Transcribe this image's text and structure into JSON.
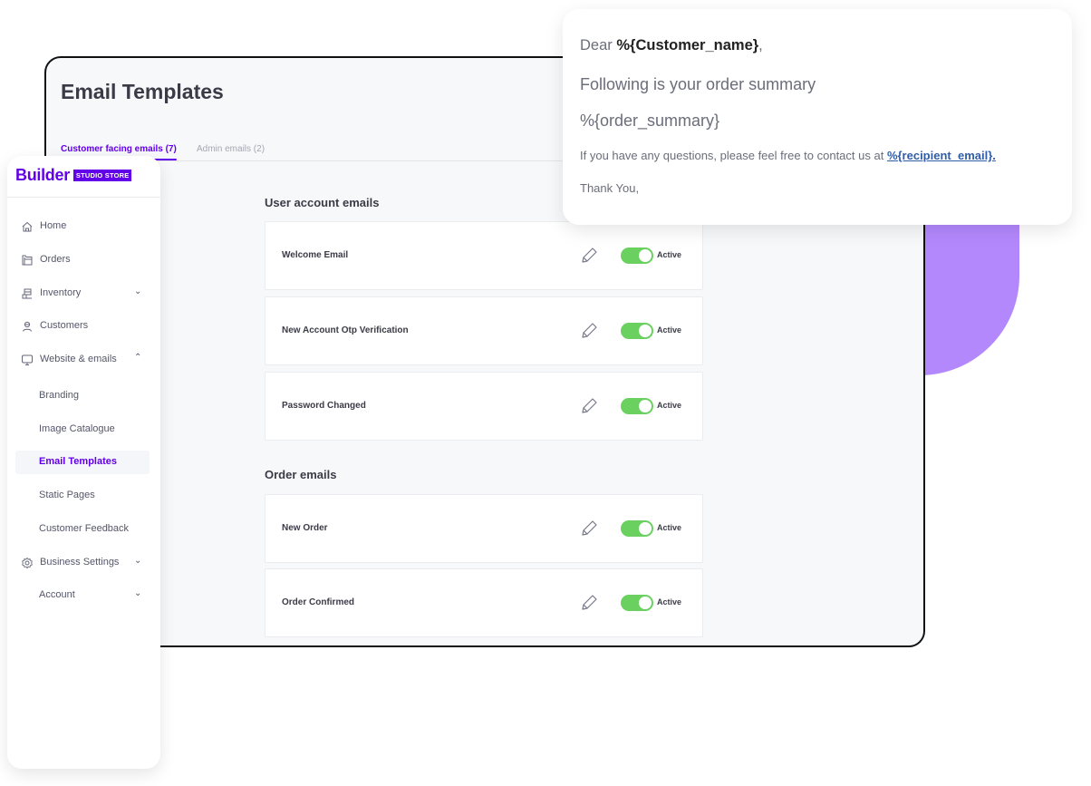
{
  "colors": {
    "brand": "#6200ea",
    "toggle_on": "#6ad160",
    "decor_purple": "#b388fd",
    "link": "#2f5da8"
  },
  "sidebar": {
    "logo": {
      "text": "Builder",
      "badge": "STUDIO STORE"
    },
    "items": [
      {
        "label": "Home",
        "icon": "home-icon"
      },
      {
        "label": "Orders",
        "icon": "orders-icon"
      },
      {
        "label": "Inventory",
        "icon": "inventory-icon",
        "chevron": "⌄"
      },
      {
        "label": "Customers",
        "icon": "customers-icon"
      },
      {
        "label": "Website & emails",
        "icon": "monitor-icon",
        "chevron": "⌃"
      },
      {
        "label": "Branding"
      },
      {
        "label": "Image Catalogue"
      },
      {
        "label": "Email Templates",
        "active": true
      },
      {
        "label": "Static Pages"
      },
      {
        "label": "Customer Feedback"
      },
      {
        "label": "Business Settings",
        "icon": "gear-icon",
        "chevron": "⌄"
      },
      {
        "label": "Account",
        "chevron": "⌄"
      }
    ]
  },
  "main": {
    "title": "Email Templates",
    "tabs": [
      {
        "label": "Customer facing emails (7)",
        "active": true
      },
      {
        "label": "Admin emails (2)",
        "active": false
      }
    ],
    "sections": [
      {
        "title": "User account emails",
        "emails": [
          {
            "name": "Welcome Email",
            "status": "Active",
            "enabled": true
          },
          {
            "name": "New Account Otp Verification",
            "status": "Active",
            "enabled": true
          },
          {
            "name": "Password Changed",
            "status": "Active",
            "enabled": true
          }
        ]
      },
      {
        "title": "Order emails",
        "emails": [
          {
            "name": "New Order",
            "status": "Active",
            "enabled": true
          },
          {
            "name": "Order Confirmed",
            "status": "Active",
            "enabled": true
          }
        ]
      }
    ]
  },
  "preview": {
    "greeting": "Dear ",
    "customer_var": "%{Customer_name}",
    "greeting_end": ",",
    "line2": "Following is your order summary",
    "line3": "%{order_summary}",
    "line4": "If you have any questions, please feel free to contact us at ",
    "recipient_var": "%{recipient_email}.",
    "line5": "Thank You,"
  }
}
